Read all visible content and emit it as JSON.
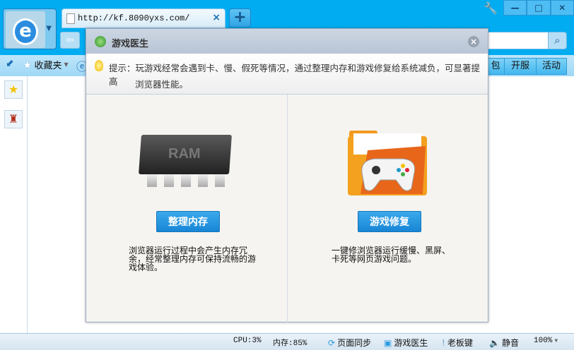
{
  "browser": {
    "tab_url": "http://kf.8090yxs.com/",
    "tab_close": "×",
    "new_tab": "+",
    "window_controls": [
      "—",
      "□",
      "✕"
    ],
    "favorites_label": "收藏夹",
    "right_tabs": [
      "包",
      "开服",
      "活动"
    ]
  },
  "dialog": {
    "title": "游戏医生",
    "tip_line1": "提示：玩游戏经常会遇到卡、慢、假死等情况，通过整理内存和游戏修复给系统减负，可显著提高",
    "tip_line2": "浏览器性能。",
    "left": {
      "chip_label": "RAM",
      "button": "整理内存",
      "desc": "浏览器运行过程中会产生内存冗余，经常整理内存可保持流畅的游戏体验。"
    },
    "right": {
      "button": "游戏修复",
      "desc": "一键修浏览器运行缓慢、黑屏、卡死等网页游戏问题。"
    }
  },
  "status": {
    "cpu": "CPU:3%",
    "memory": "内存:85%",
    "sync": "页面同步",
    "doctor": "游戏医生",
    "boss_key": "老板键",
    "mute": "静音",
    "zoom": "100%"
  }
}
